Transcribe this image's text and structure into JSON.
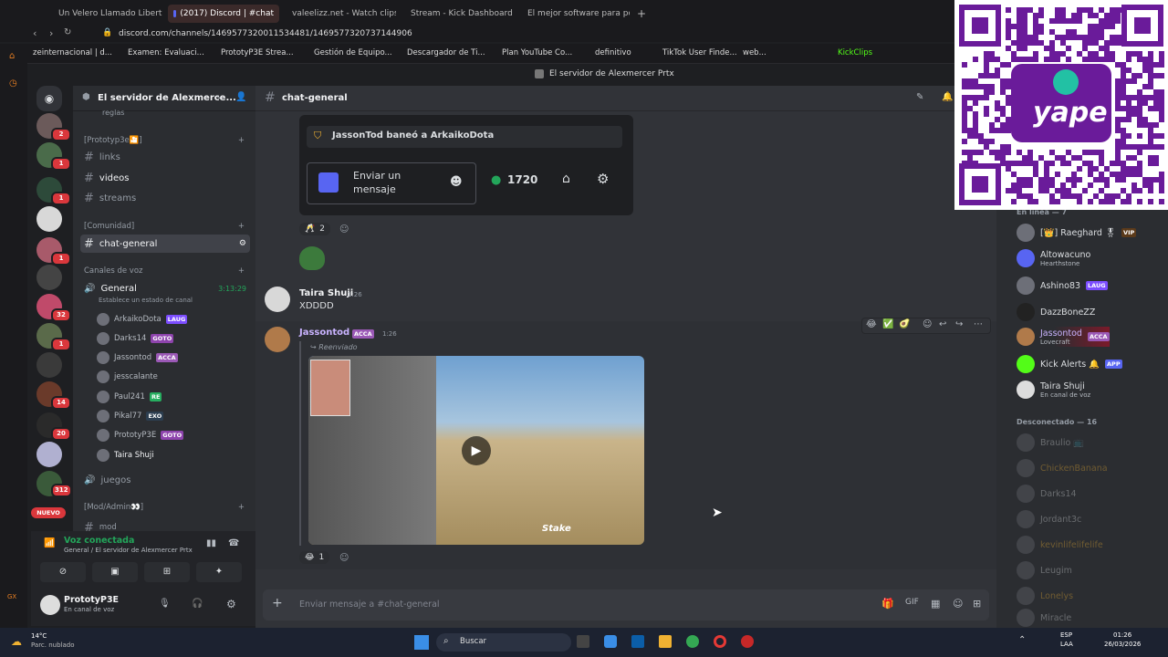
{
  "browser": {
    "tabs": [
      {
        "label": "Un Velero Llamado Liberta",
        "color": "#ff0000"
      },
      {
        "label": "(2017) Discord | #chat",
        "color": "#5865f2"
      },
      {
        "label": "valeelizz.net - Watch clips o",
        "color": "#53fc18"
      },
      {
        "label": "Stream - Kick Dashboard",
        "color": "#53fc18"
      },
      {
        "label": "El mejor software para po",
        "color": "#ffffff"
      }
    ],
    "url": "discord.com/channels/1469577320011534481/1469577320737144906",
    "bookmarks": [
      "zeinternacional | d...",
      "Examen: Evaluaci...",
      "PrototyP3E Strea...",
      "Gestión de Equipo...",
      "Descargador de Ti...",
      "Plan YouTube Co...",
      "definitivo",
      "TikTok User Finde...",
      "web...",
      "KickClips"
    ],
    "window_title": "El servidor de Alexmercer Prtx"
  },
  "server": {
    "name": "El servidor de Alexmerce...",
    "channel_header": "chat-general"
  },
  "channels": {
    "reglas": "reglas",
    "cat_prototype": "[Prototyp3e🎦]",
    "links": "links",
    "videos": "videos",
    "streams": "streams",
    "cat_comunidad": "[Comunidad]",
    "chat_general": "chat-general",
    "cat_voz": "Canales de voz",
    "general": "General",
    "general_time": "3:13:29",
    "general_status": "Establece un estado de canal",
    "voice_users": [
      {
        "name": "ArkaikoDota",
        "tag": "LAUG",
        "tag_color": "#7c4dff"
      },
      {
        "name": "Darks14",
        "tag": "GOTO",
        "tag_color": "#8e44ad"
      },
      {
        "name": "Jassontod",
        "tag": "ACCA",
        "tag_color": "#9b59b6"
      },
      {
        "name": "jesscalante",
        "tag": "",
        "tag_color": ""
      },
      {
        "name": "Paul241",
        "tag": "RE",
        "tag_color": "#27ae60"
      },
      {
        "name": "Pikal77",
        "tag": "EXO",
        "tag_color": "#2c3e50"
      },
      {
        "name": "PrototyP3E",
        "tag": "GOTO",
        "tag_color": "#8e44ad"
      },
      {
        "name": "Taira Shuji",
        "tag": "",
        "tag_color": ""
      }
    ],
    "juegos": "juegos",
    "cat_mod": "[Mod/Admin👀]",
    "mod": "mod",
    "nuevo_badge": "NUEVO"
  },
  "guild_badges": [
    "2",
    "1",
    "1",
    "1",
    "32",
    "1",
    "14",
    "20",
    "312"
  ],
  "voice_panel": {
    "status": "Voz conectada",
    "location": "General / El servidor de Alexmercer Prtx"
  },
  "user_panel": {
    "name": "PrototyP3E",
    "status": "En canal de voz"
  },
  "messages": {
    "embed_ban": "JassonTod baneó a ArkaikoDota",
    "embed_button": "Enviar un mensaje",
    "embed_count": "1720",
    "reaction1_count": "2",
    "taira_name": "Taira Shuji",
    "taira_time": "1:26",
    "taira_text": "XDDDD",
    "jasson_name": "Jassontod",
    "jasson_tag": "ACCA",
    "jasson_time": "1:26",
    "forwarded": "Reenviado",
    "reaction2_count": "1",
    "video_watermark": "Stake"
  },
  "composer": {
    "placeholder": "Enviar mensaje a #chat-general"
  },
  "members": {
    "online_header": "En línea — 7",
    "online": [
      {
        "name": "[👑] Raeghard 🎖",
        "tag": "VIP",
        "sub": ""
      },
      {
        "name": "Altowacuno",
        "tag": "",
        "sub": "Hearthstone"
      },
      {
        "name": "Ashino83",
        "tag": "LAUG",
        "sub": ""
      },
      {
        "name": "DazzBoneZZ",
        "tag": "",
        "sub": ""
      },
      {
        "name": "Jassontod",
        "tag": "ACCA",
        "sub": "Lovecraft"
      },
      {
        "name": "Kick Alerts 🔔",
        "tag": "APP",
        "sub": ""
      },
      {
        "name": "Taira Shuji",
        "tag": "",
        "sub": "En canal de voz"
      }
    ],
    "offline_header": "Desconectado — 16",
    "offline": [
      "Braulio 📺",
      "ChickenBanana",
      "Darks14",
      "Jordant3c",
      "kevinlifelifelife",
      "Leugim",
      "Lonelys",
      "Miracle"
    ]
  },
  "taskbar": {
    "weather_temp": "14°C",
    "weather_desc": "Parc. nublado",
    "search": "Buscar",
    "lang": "ESP",
    "lang2": "LAA",
    "time": "01:26",
    "date": "26/03/2026"
  },
  "overlay": {
    "brand": "yape"
  }
}
